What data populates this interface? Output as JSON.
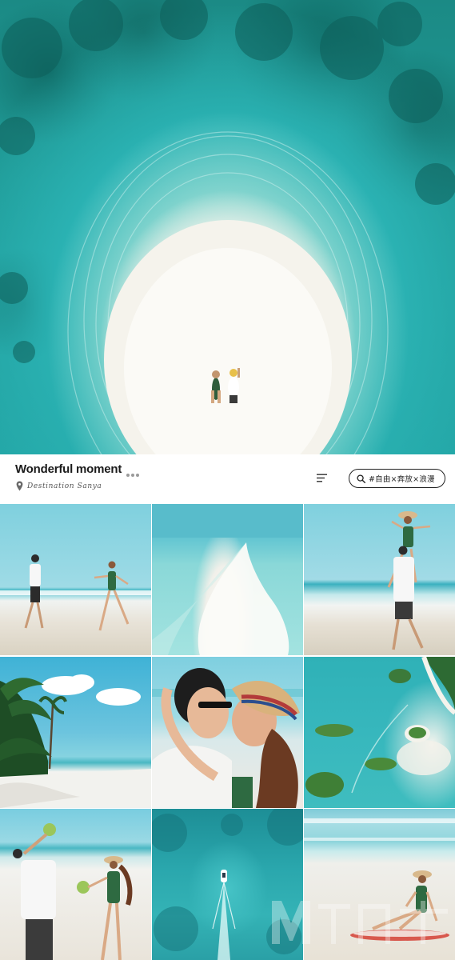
{
  "header": {
    "title": "Wonderful moment",
    "location": "Destination Sanya",
    "tag": "#自由×奔放×浪漫"
  },
  "icons": {
    "more": "more-dots-icon",
    "location": "location-pin-icon",
    "menu": "menu-lines-icon",
    "search": "search-icon"
  },
  "colors": {
    "title": "#1b1b1b",
    "accent_teal": "#2bb3b4",
    "pill_border": "#222222"
  },
  "gallery": [
    {
      "name": "photo-couple-beach-walk"
    },
    {
      "name": "photo-aerial-sandbar"
    },
    {
      "name": "photo-shoulder-ride"
    },
    {
      "name": "photo-palm-beach"
    },
    {
      "name": "photo-couple-kiss"
    },
    {
      "name": "photo-aerial-islands"
    },
    {
      "name": "photo-coconut-drink"
    },
    {
      "name": "photo-aerial-boat"
    },
    {
      "name": "photo-surfboard-pose"
    }
  ]
}
